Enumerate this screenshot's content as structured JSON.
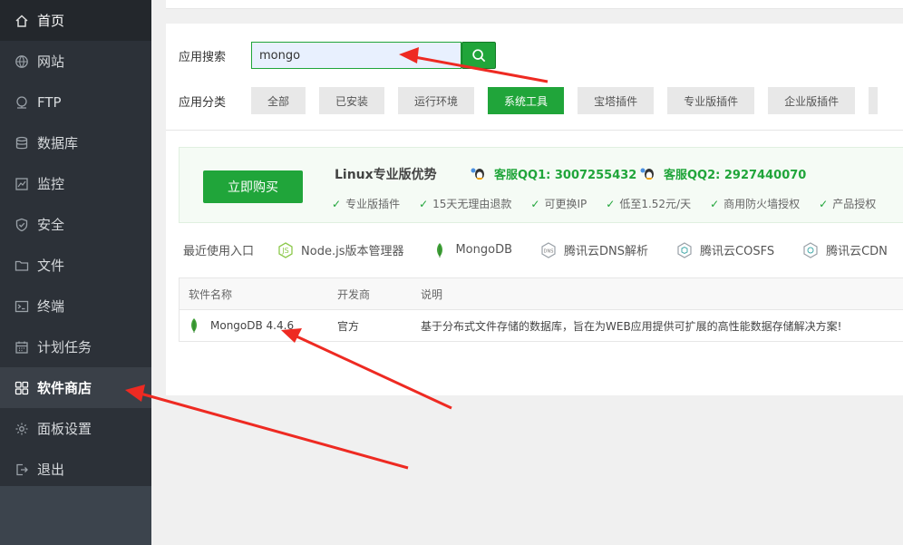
{
  "sidebar": {
    "items": [
      {
        "label": "首页",
        "icon": "home-icon"
      },
      {
        "label": "网站",
        "icon": "globe-icon"
      },
      {
        "label": "FTP",
        "icon": "ftp-icon"
      },
      {
        "label": "数据库",
        "icon": "database-icon"
      },
      {
        "label": "监控",
        "icon": "monitor-icon"
      },
      {
        "label": "安全",
        "icon": "shield-icon"
      },
      {
        "label": "文件",
        "icon": "folder-icon"
      },
      {
        "label": "终端",
        "icon": "terminal-icon"
      },
      {
        "label": "计划任务",
        "icon": "calendar-icon"
      },
      {
        "label": "软件商店",
        "icon": "grid-icon"
      },
      {
        "label": "面板设置",
        "icon": "gear-icon"
      },
      {
        "label": "退出",
        "icon": "logout-icon"
      }
    ],
    "active_index": 9
  },
  "search": {
    "label": "应用搜索",
    "value": "mongo"
  },
  "categories": {
    "label": "应用分类",
    "items": [
      "全部",
      "已安装",
      "运行环境",
      "系统工具",
      "宝塔插件",
      "专业版插件",
      "企业版插件"
    ],
    "active": "系统工具"
  },
  "promo": {
    "buy_label": "立即购买",
    "title": "Linux专业版优势",
    "qq1": "客服QQ1: 3007255432",
    "qq2": "客服QQ2: 2927440070",
    "features": [
      "专业版插件",
      "15天无理由退款",
      "可更换IP",
      "低至1.52元/天",
      "商用防火墙授权",
      "产品授权"
    ]
  },
  "recent": {
    "label": "最近使用入口",
    "items": [
      {
        "label": "Node.js版本管理器",
        "icon": "nodejs-icon"
      },
      {
        "label": "MongoDB",
        "icon": "mongodb-leaf-icon"
      },
      {
        "label": "腾讯云DNS解析",
        "icon": "dns-icon"
      },
      {
        "label": "腾讯云COSFS",
        "icon": "cosfs-icon"
      },
      {
        "label": "腾讯云CDN",
        "icon": "cdn-icon"
      }
    ]
  },
  "table": {
    "headers": [
      "软件名称",
      "开发商",
      "说明"
    ],
    "rows": [
      {
        "name": "MongoDB 4.4.6",
        "vendor": "官方",
        "desc": "基于分布式文件存储的数据库，旨在为WEB应用提供可扩展的高性能数据存储解决方案!"
      }
    ]
  },
  "colors": {
    "accent": "#20a53a",
    "sidebar_bg": "#2c3138",
    "arrow": "#ee2a22"
  }
}
